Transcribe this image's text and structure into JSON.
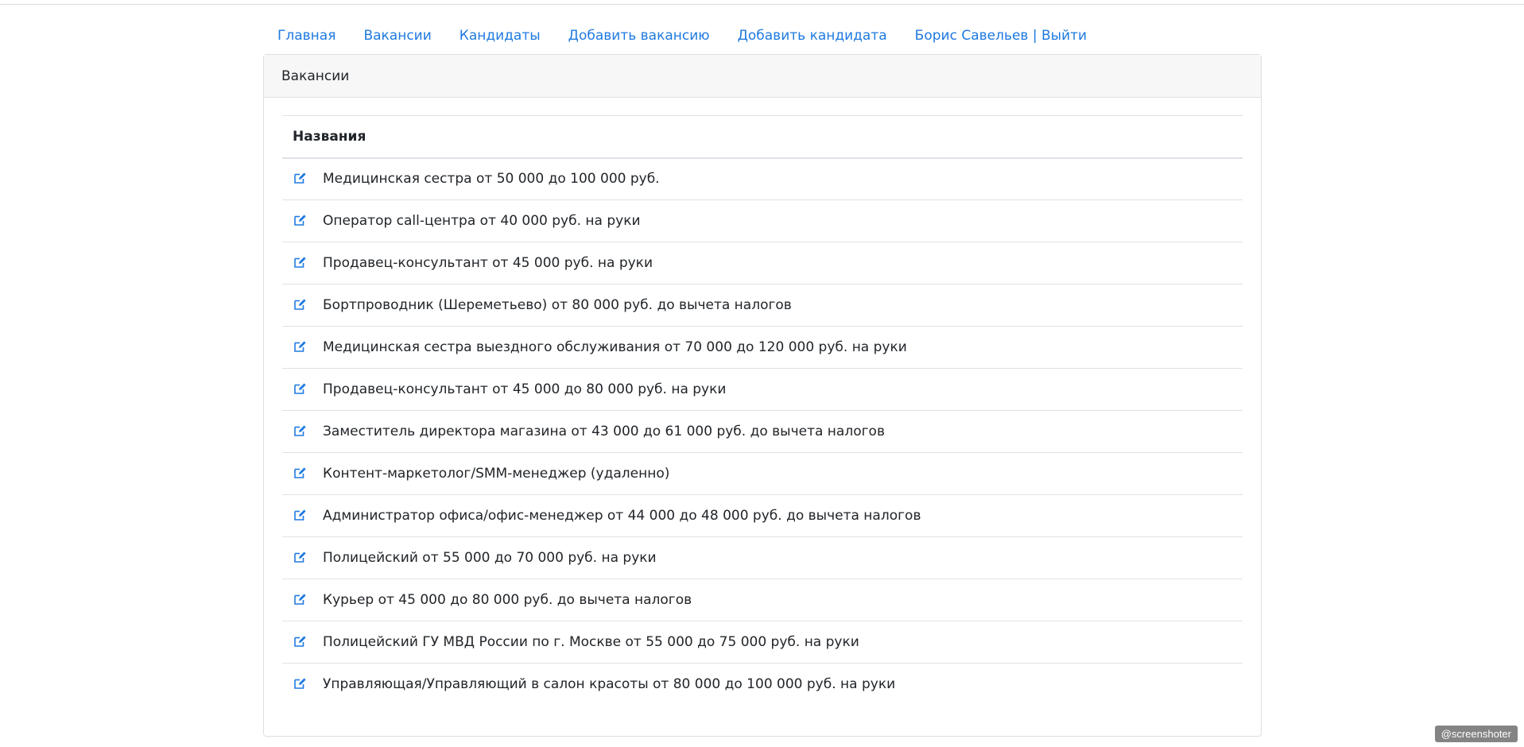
{
  "nav": {
    "items": [
      {
        "label": "Главная"
      },
      {
        "label": "Вакансии"
      },
      {
        "label": "Кандидаты"
      },
      {
        "label": "Добавить вакансию"
      },
      {
        "label": "Добавить кандидата"
      },
      {
        "label": "Борис Савельев | Выйти"
      }
    ]
  },
  "card": {
    "title": "Вакансии",
    "table": {
      "column_header": "Названия",
      "edit_icon": "edit-pencil-square-icon",
      "rows": [
        {
          "name": "Медицинская сестра от 50 000 до 100 000 руб."
        },
        {
          "name": "Оператор call-центра от 40 000 руб. на руки"
        },
        {
          "name": "Продавец-консультант от 45 000 руб. на руки"
        },
        {
          "name": "Бортпроводник (Шереметьево) от 80 000 руб. до вычета налогов"
        },
        {
          "name": "Медицинская сестра выездного обслуживания от 70 000 до 120 000 руб. на руки"
        },
        {
          "name": "Продавец-консультант от 45 000 до 80 000 руб. на руки"
        },
        {
          "name": "Заместитель директора магазина от 43 000 до 61 000 руб. до вычета налогов"
        },
        {
          "name": "Контент-маркетолог/SMM-менеджер (удаленно)"
        },
        {
          "name": "Администратор офиса/офис-менеджер от 44 000 до 48 000 руб. до вычета налогов"
        },
        {
          "name": "Полицейский от 55 000 до 70 000 руб. на руки"
        },
        {
          "name": "Курьер от 45 000 до 80 000 руб. до вычета налогов"
        },
        {
          "name": "Полицейский ГУ МВД России по г. Москве от 55 000 до 75 000 руб. на руки"
        },
        {
          "name": "Управляющая/Управляющий в салон красоты от 80 000 до 100 000 руб. на руки"
        }
      ]
    }
  },
  "watermark": "@screenshoter",
  "colors": {
    "link": "#1f7ae0",
    "text": "#212529",
    "header_bg": "#f7f7f7",
    "border": "#dee2e6"
  }
}
